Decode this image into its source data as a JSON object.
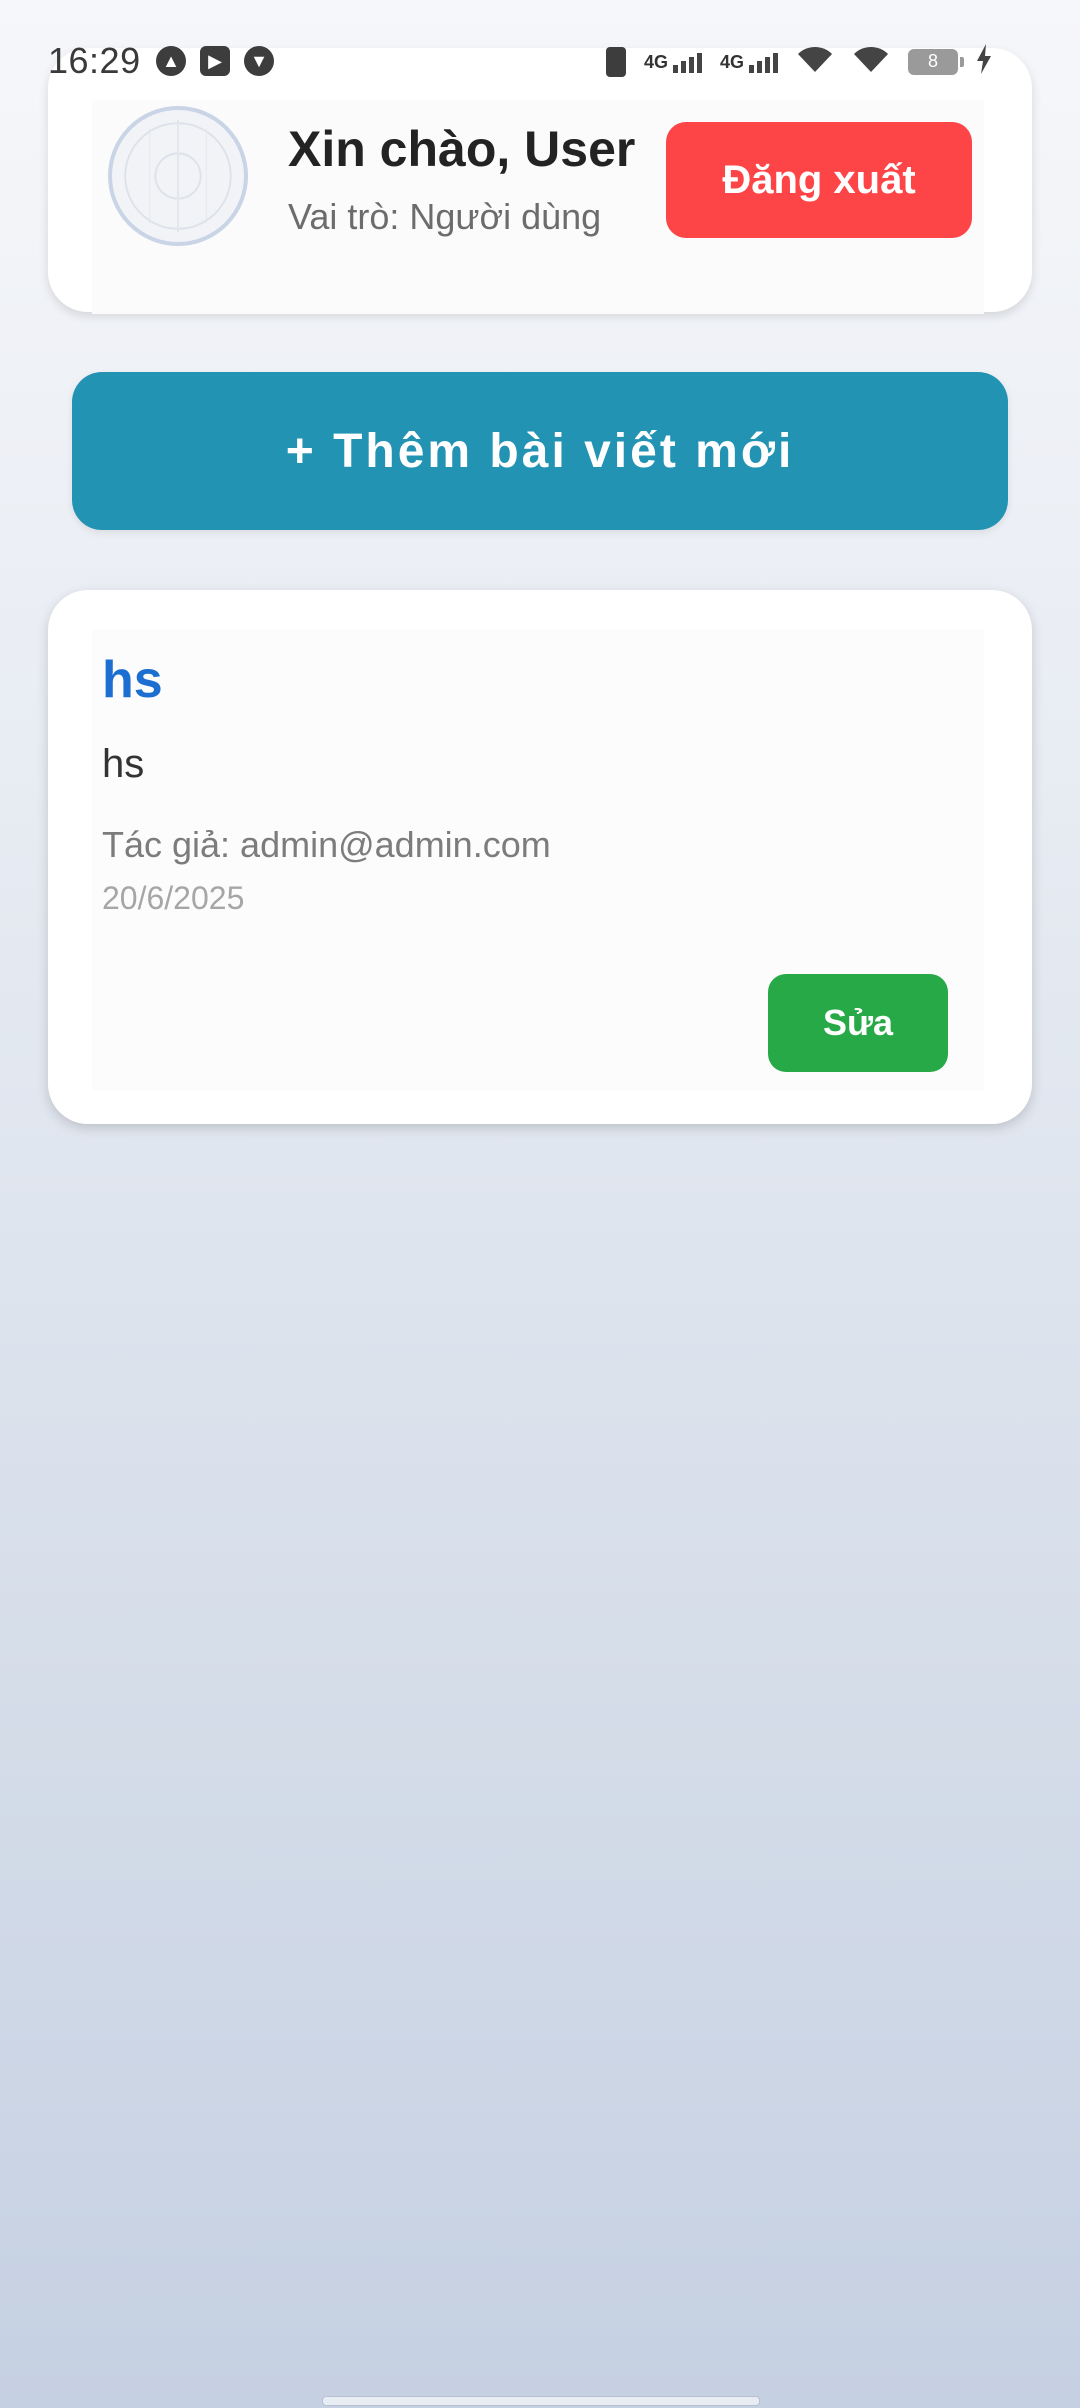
{
  "status_bar": {
    "time": "16:29",
    "network_1": "4G",
    "network_2": "4G",
    "battery": "8"
  },
  "header": {
    "greeting": "Xin chào, User",
    "role": "Vai trò: Người dùng",
    "logout_label": "Đăng xuất",
    "logout_color": "#fd4447"
  },
  "actions": {
    "add_post_label": "+ Thêm bài viết mới",
    "add_post_color": "#2393b3"
  },
  "posts": [
    {
      "title": "hs",
      "content": "hs",
      "author": "Tác giả: admin@admin.com",
      "date": "20/6/2025",
      "edit_label": "Sửa",
      "edit_color": "#26a946"
    }
  ]
}
